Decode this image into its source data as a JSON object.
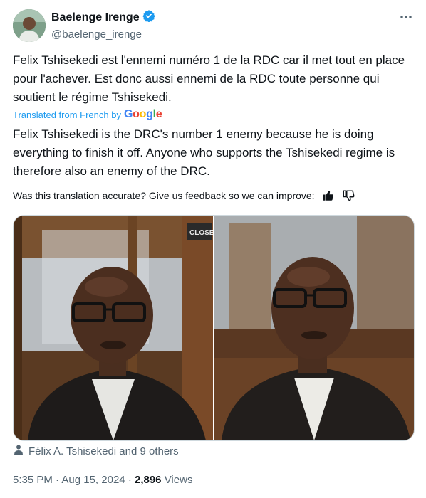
{
  "author": {
    "name": "Baelenge Irenge",
    "handle": "@baelenge_irenge"
  },
  "post": {
    "original_text": "Felix Tshisekedi est l'ennemi numéro 1 de la RDC car il met tout en place pour l'achever. Est donc aussi ennemi de la RDC toute personne qui soutient le régime Tshisekedi.",
    "translated_by": "Translated from French by",
    "google_label": "Google",
    "translated_text": "Felix Tshisekedi is the DRC's number 1 enemy because he is doing everything to finish it off. Anyone who supports the Tshisekedi regime is therefore also an enemy of the DRC.",
    "feedback_prompt": "Was this translation accurate? Give us feedback so we can improve:",
    "photo_sign": "CLOSE",
    "tagged": "Félix A. Tshisekedi and 9 others",
    "time": "5:35 PM",
    "date": "Aug 15, 2024",
    "views_count": "2,896",
    "views_label": "Views"
  },
  "colors": {
    "accent": "#1d9bf0",
    "secondary_text": "#536471"
  },
  "icons": [
    "verified-badge-icon",
    "more-icon",
    "thumbs-up-icon",
    "thumbs-down-icon",
    "person-icon"
  ]
}
